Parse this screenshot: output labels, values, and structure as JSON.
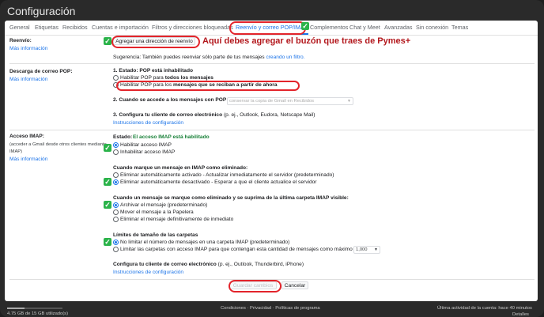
{
  "window": {
    "title": "Configuración"
  },
  "tabs": [
    "General",
    "Etiquetas",
    "Recibidos",
    "Cuentas e importación",
    "Filtros y direcciones bloqueadas",
    "Reenvío y correo POP/IMAP",
    "Complementos",
    "Chat y Meet",
    "Avanzadas",
    "Sin conexión",
    "Temas"
  ],
  "annotation": "Aquí debes agregar el buzón que traes de Pymes+",
  "forward": {
    "heading": "Reenvío:",
    "learn_more": "Más información",
    "add_button": "Agregar una dirección de reenvío",
    "tip_prefix": "Sugerencia: También puedes reenviar sólo parte de tus mensajes",
    "tip_link": "creando un filtro."
  },
  "pop": {
    "heading": "Descarga de correo POP:",
    "learn_more": "Más información",
    "status": "1. Estado: POP está inhabilitado",
    "opt1_prefix": "Habilitar POP para",
    "opt1_bold": "todos los mensajes",
    "opt2_prefix": "Habilitar POP para los",
    "opt2_bold": "mensajes que se reciban a partir de ahora",
    "q2": "2. Cuando se accede a los mensajes con POP",
    "q2_select": "conservar la copia de Gmail en Recibidos",
    "q3_bold": "3. Configura tu cliente de correo electrónico",
    "q3_rest": "(p. ej., Outlook, Eudora, Netscape Mail)",
    "q3_link": "Instrucciones de configuración"
  },
  "imap": {
    "heading": "Acceso IMAP:",
    "sub1": "(acceder a Gmail desde otros clientes mediante",
    "sub2": "IMAP)",
    "learn_more": "Más información",
    "status_label": "Estado:",
    "status_value": "El acceso IMAP está habilitado",
    "enable": "Habilitar acceso IMAP",
    "disable": "Inhabilitar acceso IMAP",
    "deleted_heading": "Cuando marque un mensaje en IMAP como eliminado:",
    "deleted_opt1": "Eliminar automáticamente activado - Actualizar inmediatamente el servidor (predeterminado)",
    "deleted_opt2": "Eliminar automáticamente desactivado - Esperar a que el cliente actualice el servidor",
    "expunge_heading": "Cuando un mensaje se marque como eliminado y se suprima de la última carpeta IMAP visible:",
    "expunge_opt1": "Archivar el mensaje (predeterminado)",
    "expunge_opt2": "Mover el mensaje a la Papelera",
    "expunge_opt3": "Eliminar el mensaje definitivamente de inmediato",
    "folder_heading": "Límites de tamaño de las carpetas",
    "folder_opt1": "No limitar el número de mensajes en una carpeta IMAP (predeterminado)",
    "folder_opt2": "Limitar las carpetas con acceso IMAP para que contengan esta cantidad de mensajes como máximo",
    "folder_select": "1,000",
    "client_bold": "Configura tu cliente de correo electrónico",
    "client_rest": "(p. ej., Outlook, Thunderbird, iPhone)",
    "client_link": "Instrucciones de configuración"
  },
  "actions": {
    "save": "Guardar cambios",
    "cancel": "Cancelar"
  },
  "footer": {
    "storage": "4.75 GB de 15 GB utilizado(s)",
    "storage_fraction": 0.32,
    "links": "Condiciones · Privacidad · Políticas de programa",
    "activity": "Última actividad de la cuenta: hace 40 minutos",
    "details": "Detalles"
  },
  "colors": {
    "accent": "#1a73e8",
    "annotation_red": "#e3242b",
    "check_green": "#2bb34a",
    "status_green": "#188038"
  }
}
